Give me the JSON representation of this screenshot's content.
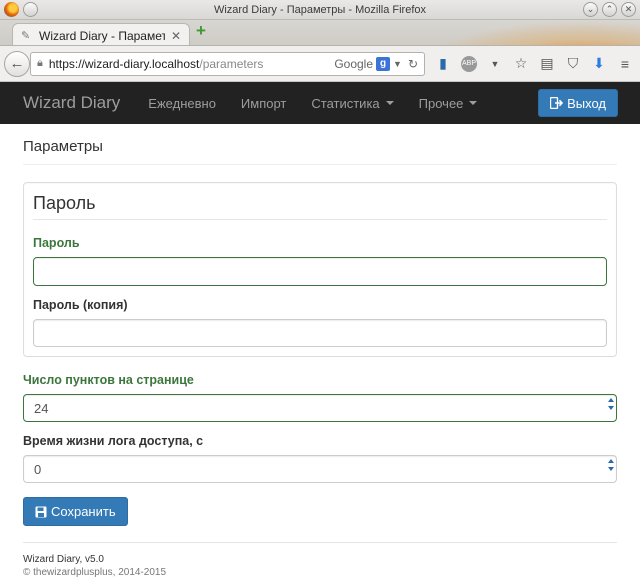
{
  "window": {
    "title": "Wizard Diary - Параметры - Mozilla Firefox"
  },
  "browser": {
    "tab_title": "Wizard Diary - Параметры",
    "url_host": "https://wizard-diary.localhost",
    "url_path": "/parameters",
    "search_engine": "Google"
  },
  "navbar": {
    "brand": "Wizard Diary",
    "items": [
      {
        "label": "Ежедневно"
      },
      {
        "label": "Импорт"
      },
      {
        "label": "Статистика"
      },
      {
        "label": "Прочее"
      }
    ],
    "logout_label": "Выход"
  },
  "page": {
    "header": "Параметры",
    "password_section": {
      "legend": "Пароль",
      "password_label": "Пароль",
      "password_value": "",
      "password_copy_label": "Пароль (копия)",
      "password_copy_value": ""
    },
    "items_per_page_label": "Число пунктов на странице",
    "items_per_page_value": "24",
    "access_log_lifetime_label": "Время жизни лога доступа, с",
    "access_log_lifetime_value": "0",
    "save_label": "Сохранить"
  },
  "footer": {
    "version": "Wizard Diary, v5.0",
    "copyright": "© thewizardplusplus, 2014-2015"
  },
  "colors": {
    "navbar_bg": "#222222",
    "primary": "#337ab7",
    "success": "#3c763d"
  }
}
